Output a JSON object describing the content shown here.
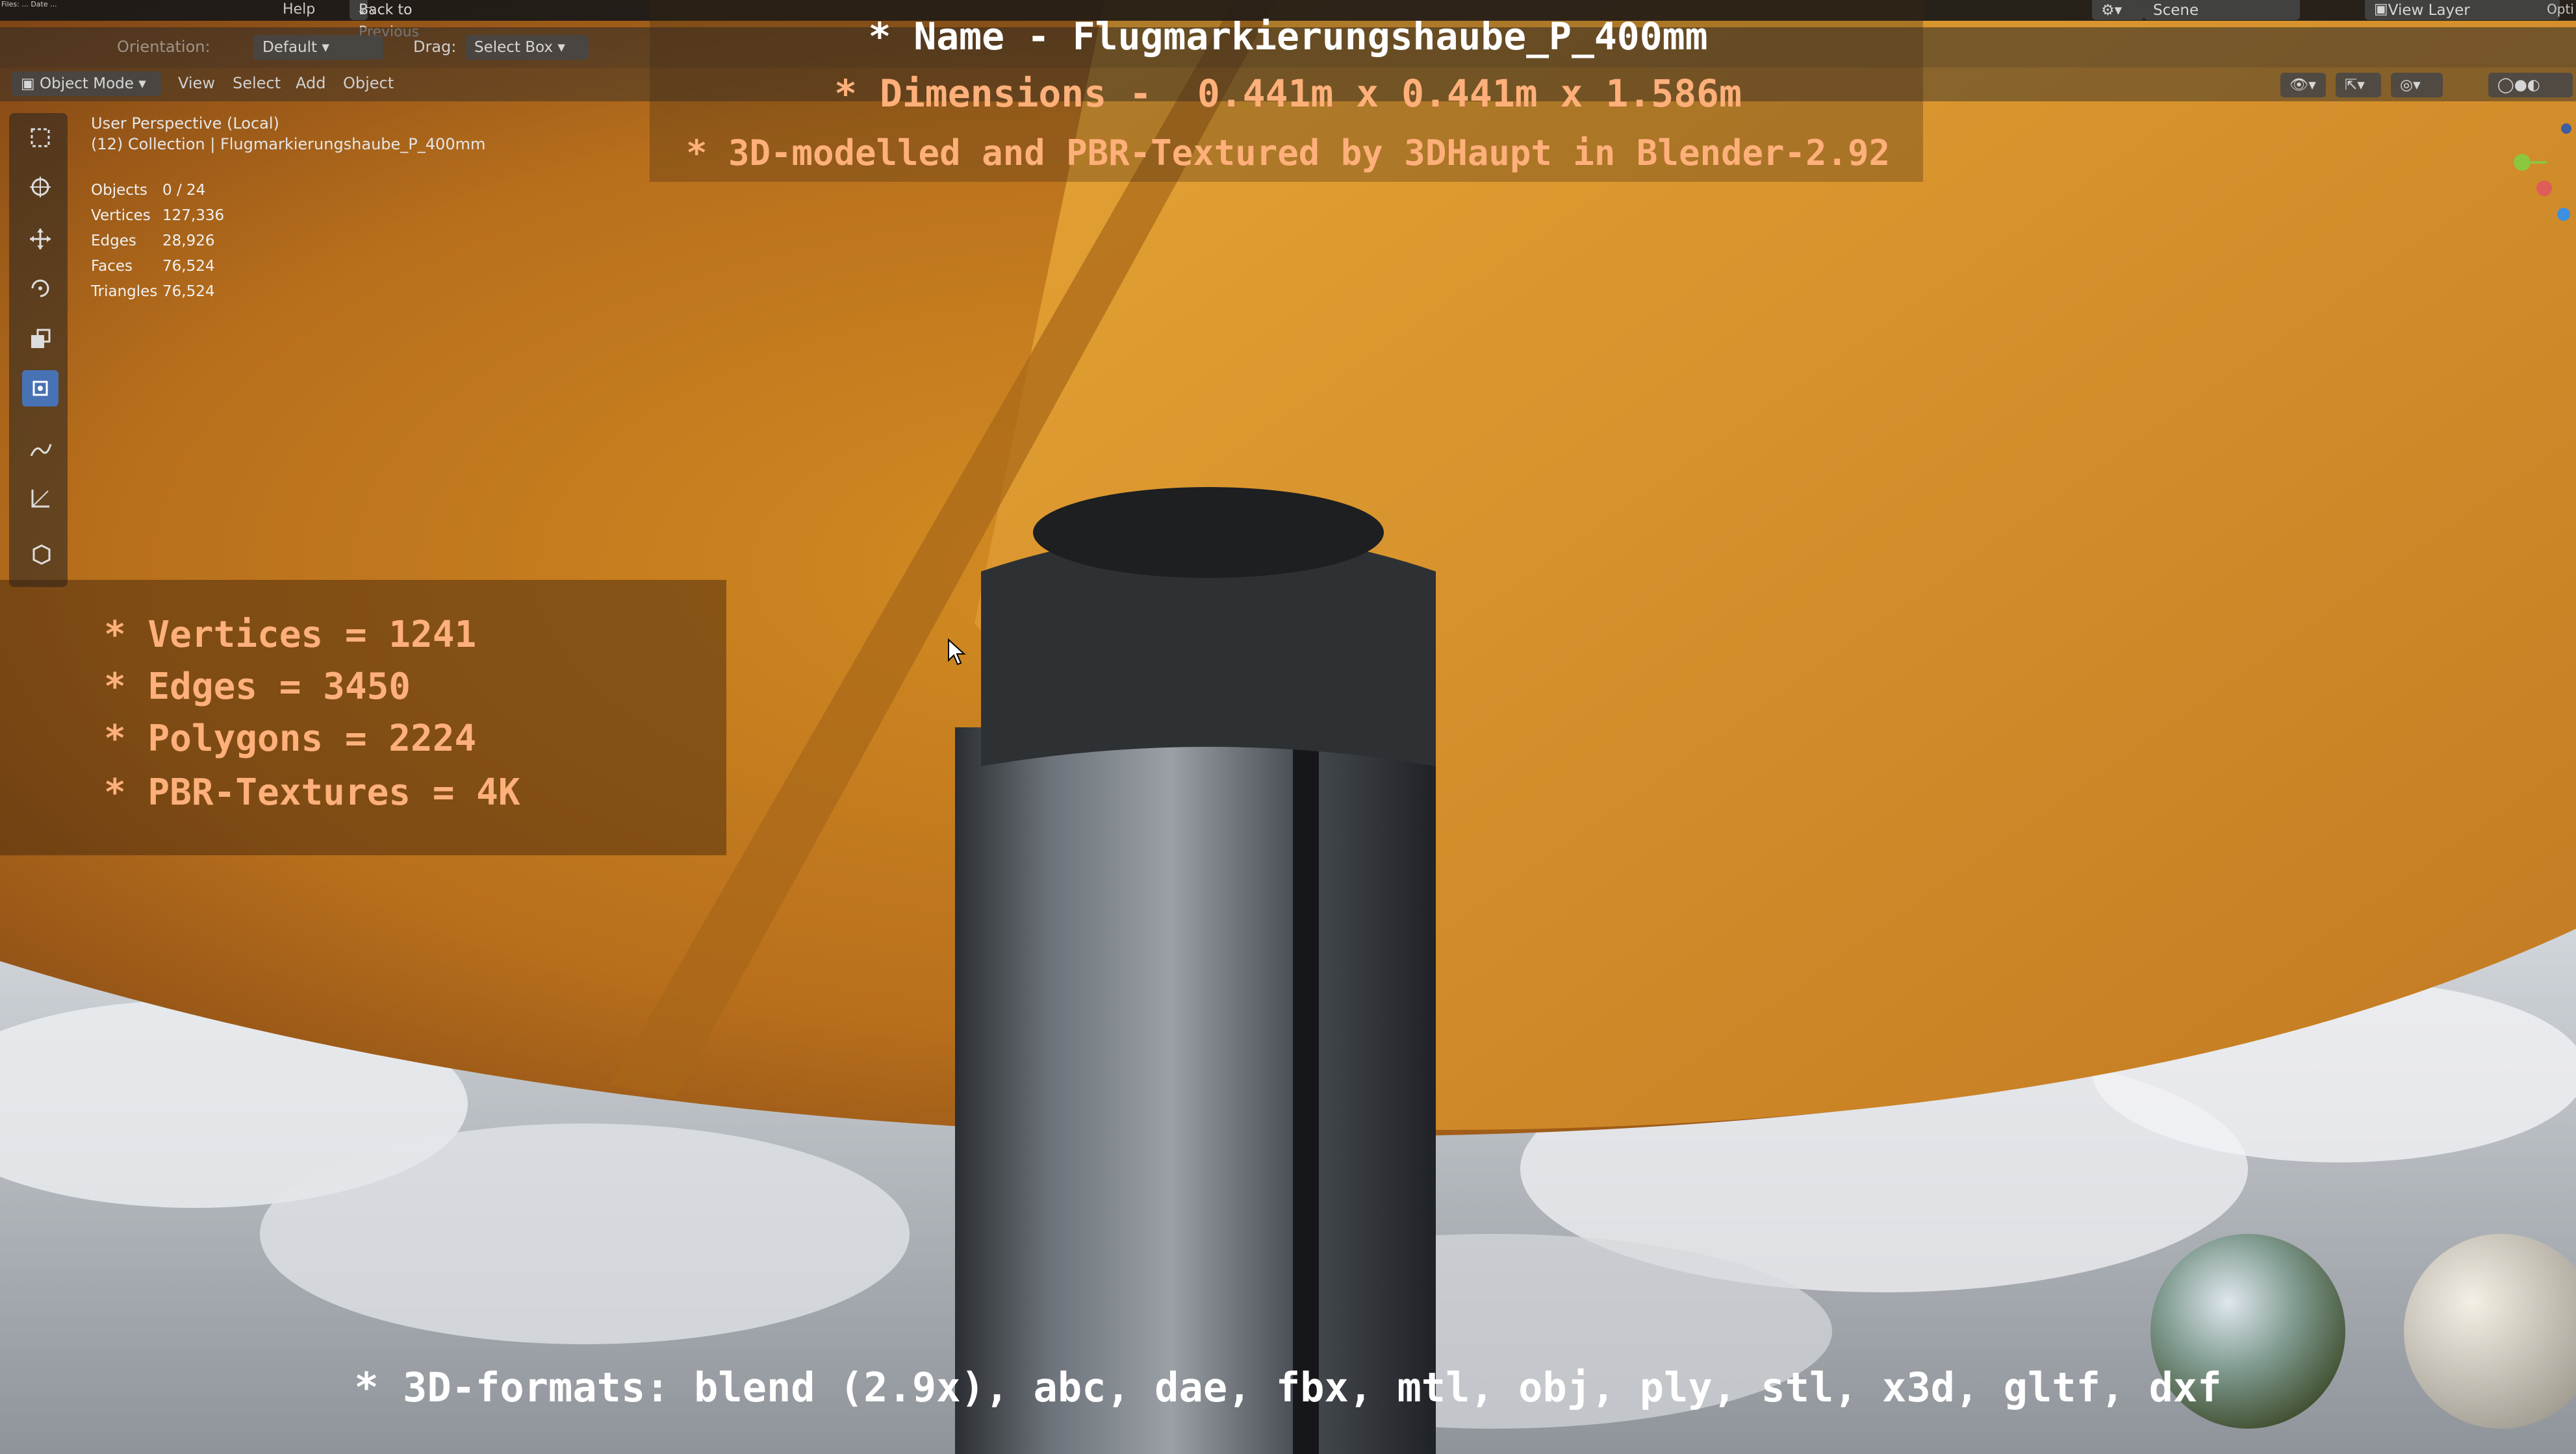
{
  "topbar": {
    "menu_help": "Help",
    "back_button": "Back to Previous",
    "scene": "Scene",
    "view_layer": "View Layer",
    "options": "Opti"
  },
  "toolbar": {
    "orientation_label": "Orientation:",
    "orientation_value": "Default",
    "drag_label": "Drag:",
    "drag_value": "Select Box"
  },
  "header": {
    "mode": "Object Mode",
    "menus": [
      "View",
      "Select",
      "Add",
      "Object"
    ]
  },
  "overlay": {
    "name_line": "* Name - Flugmarkierungshaube_P_400mm",
    "dimensions_line": "* Dimensions -  0.441m x 0.441m x 1.586m",
    "modelled_line": "* 3D-modelled and PBR-Textured by 3DHaupt in Blender-2.92",
    "stats_lines": [
      "* Vertices = 1241",
      "* Edges = 3450",
      "* Polygons = 2224",
      "* PBR-Textures = 4K"
    ],
    "formats_line": "* 3D-formats: blend (2.9x), abc, dae, fbx, mtl, obj, ply, stl, x3d, gltf, dxf"
  },
  "viewport": {
    "perspective": "User Perspective (Local)",
    "collection": "(12) Collection | Flugmarkierungshaube_P_400mm",
    "stats": [
      {
        "label": "Objects",
        "value": "0 / 24"
      },
      {
        "label": "Vertices",
        "value": "127,336"
      },
      {
        "label": "Edges",
        "value": "28,926"
      },
      {
        "label": "Faces",
        "value": "76,524"
      },
      {
        "label": "Triangles",
        "value": "76,524"
      }
    ]
  },
  "colors": {
    "ui_dark": "#181818",
    "accent_blue": "#4772b3",
    "cone_yellow": "#e0a020",
    "overlay_orange": "#ffb07a"
  }
}
